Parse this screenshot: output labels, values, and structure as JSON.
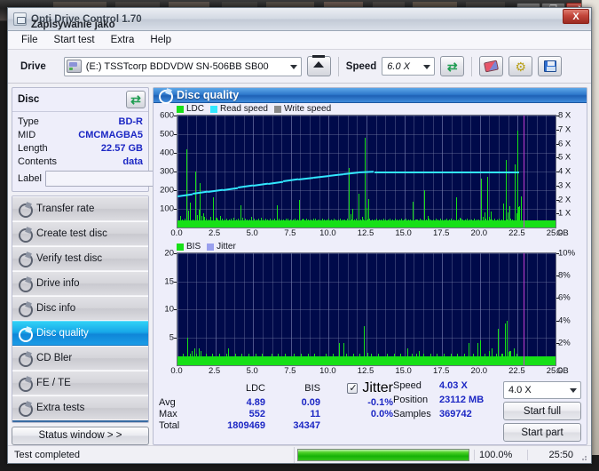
{
  "window": {
    "title": "Opti Drive Control 1.70",
    "subtitle": "Zapisywanie jako",
    "close_label": "X",
    "bg_minimize_label": "—",
    "bg_maximize_label": "❐",
    "bg_close_label": "X"
  },
  "menu": {
    "items": [
      {
        "label": "File"
      },
      {
        "label": "Start test"
      },
      {
        "label": "Extra"
      },
      {
        "label": "Help"
      }
    ]
  },
  "toolbar": {
    "drive_label": "Drive",
    "drive_value": "(E:)   TSSTcorp BDDVDW SN-506BB SB00",
    "eject_name": "eject-button",
    "speed_label": "Speed",
    "speed_value": "6.0 X",
    "refresh_glyph": "⇄",
    "gear_glyph": "⚙"
  },
  "disc": {
    "header": "Disc",
    "rows": [
      {
        "key": "Type",
        "value": "BD-R"
      },
      {
        "key": "MID",
        "value": "CMCMAGBA5"
      },
      {
        "key": "Length",
        "value": "22.57 GB"
      },
      {
        "key": "Contents",
        "value": "data"
      }
    ],
    "label_key": "Label",
    "label_value": "",
    "label_placeholder": ""
  },
  "sidebar": {
    "items": [
      {
        "label": "Transfer rate",
        "selected": false
      },
      {
        "label": "Create test disc",
        "selected": false
      },
      {
        "label": "Verify test disc",
        "selected": false
      },
      {
        "label": "Drive info",
        "selected": false
      },
      {
        "label": "Disc info",
        "selected": false
      },
      {
        "label": "Disc quality",
        "selected": true
      },
      {
        "label": "CD Bler",
        "selected": false
      },
      {
        "label": "FE / TE",
        "selected": false
      },
      {
        "label": "Extra tests",
        "selected": false
      }
    ],
    "status_button": "Status window > >"
  },
  "content": {
    "title": "Disc quality"
  },
  "chart_data": [
    {
      "id": "ldc-chart",
      "type": "bar",
      "title": "Disc quality",
      "xlabel": "GB",
      "ylabel": "LDC",
      "xlim": [
        0,
        25
      ],
      "ylim": [
        0,
        600
      ],
      "y2lim": [
        0,
        8
      ],
      "y2label": "X",
      "grid": true,
      "legend_position": "top-left",
      "xticks": [
        "0.0",
        "2.5",
        "5.0",
        "7.5",
        "10.0",
        "12.5",
        "15.0",
        "17.5",
        "20.0",
        "22.5",
        "25.0"
      ],
      "xunit": "GB",
      "yticks": [
        100,
        200,
        300,
        400,
        500,
        600
      ],
      "y2ticks": [
        "1 X",
        "2 X",
        "3 X",
        "4 X",
        "5 X",
        "6 X",
        "7 X",
        "8 X"
      ],
      "legend": [
        {
          "name": "LDC",
          "color": "#17e017"
        },
        {
          "name": "Read speed",
          "color": "#32e8ff"
        },
        {
          "name": "Write speed",
          "color": "#8a8a8a"
        }
      ],
      "series": [
        {
          "name": "LDC",
          "color": "#17e017",
          "x": [
            0.05,
            0.18,
            0.3,
            0.45,
            0.6,
            0.72,
            0.85,
            1.0,
            1.15,
            1.3,
            1.45,
            1.6,
            1.75,
            1.9,
            2.05,
            2.2,
            2.35,
            2.5,
            2.65,
            2.8,
            2.95,
            3.1,
            3.25,
            3.4,
            3.55,
            3.7,
            3.85,
            4.0,
            4.15,
            4.3,
            4.45,
            4.6,
            4.75,
            4.9,
            5.05,
            5.2,
            5.35,
            5.5,
            5.65,
            5.8,
            5.95,
            6.1,
            6.25,
            6.4,
            6.55,
            6.7,
            6.85,
            7.0,
            7.15,
            7.3,
            7.45,
            7.6,
            7.75,
            7.9,
            8.05,
            8.2,
            8.35,
            8.5,
            8.65,
            8.8,
            8.95,
            9.1,
            9.25,
            9.4,
            9.55,
            9.7,
            9.85,
            10.0,
            10.15,
            10.3,
            10.45,
            10.6,
            10.75,
            10.9,
            11.05,
            11.2,
            11.35,
            11.5,
            11.65,
            11.8,
            11.95,
            12.1,
            12.25,
            12.4,
            12.55,
            12.7,
            12.85,
            13.0,
            13.15,
            13.3,
            13.45,
            13.6,
            13.75,
            13.9,
            14.05,
            14.2,
            14.35,
            14.5,
            14.65,
            14.8,
            14.95,
            15.1,
            15.25,
            15.4,
            15.55,
            15.7,
            15.85,
            16.0,
            16.15,
            16.3,
            16.45,
            16.6,
            16.75,
            16.9,
            17.05,
            17.2,
            17.35,
            17.5,
            17.65,
            17.8,
            17.95,
            18.1,
            18.25,
            18.4,
            18.55,
            18.7,
            18.85,
            19.0,
            19.15,
            19.3,
            19.45,
            19.6,
            19.75,
            19.9,
            20.05,
            20.2,
            20.35,
            20.5,
            20.65,
            20.8,
            20.95,
            21.1,
            21.25,
            21.4,
            21.55,
            21.7,
            21.85,
            22.0,
            22.15,
            22.3,
            22.45,
            22.6
          ],
          "values": [
            40,
            60,
            45,
            50,
            420,
            70,
            55,
            45,
            300,
            50,
            240,
            60,
            55,
            48,
            42,
            55,
            160,
            52,
            45,
            60,
            48,
            44,
            50,
            42,
            46,
            52,
            44,
            46,
            120,
            52,
            48,
            45,
            44,
            58,
            46,
            44,
            48,
            52,
            44,
            46,
            42,
            48,
            44,
            46,
            120,
            50,
            44,
            42,
            46,
            48,
            44,
            42,
            46,
            44,
            150,
            44,
            42,
            46,
            44,
            42,
            46,
            48,
            44,
            42,
            46,
            44,
            42,
            48,
            44,
            46,
            42,
            44,
            48,
            44,
            42,
            46,
            320,
            44,
            42,
            46,
            180,
            44,
            42,
            480,
            44,
            46,
            42,
            44,
            48,
            44,
            42,
            46,
            44,
            42,
            48,
            44,
            46,
            42,
            44,
            48,
            44,
            46,
            42,
            44,
            140,
            44,
            42,
            46,
            44,
            200,
            42,
            46,
            44,
            42,
            48,
            44,
            46,
            42,
            44,
            48,
            44,
            46,
            42,
            160,
            44,
            46,
            42,
            44,
            48,
            44,
            42,
            46,
            44,
            42,
            260,
            44,
            46,
            270,
            44,
            42,
            48,
            44,
            46,
            42,
            130,
            360,
            44,
            46,
            42,
            340,
            520,
            44,
            46,
            120
          ]
        },
        {
          "name": "Read speed",
          "color": "#32e8ff",
          "x": [
            0.0,
            1.0,
            2.0,
            3.0,
            4.0,
            5.0,
            6.0,
            7.0,
            8.0,
            9.0,
            10.0,
            11.0,
            12.0,
            13.0,
            14.0,
            15.0,
            16.0,
            17.0,
            18.0,
            19.0,
            20.0,
            21.0,
            22.0,
            22.6
          ],
          "values": [
            2.3,
            2.45,
            2.6,
            2.75,
            2.9,
            3.05,
            3.2,
            3.35,
            3.5,
            3.62,
            3.74,
            3.86,
            3.98,
            4.03,
            4.03,
            4.03,
            4.03,
            4.03,
            4.03,
            4.03,
            4.03,
            4.03,
            4.03,
            4.03
          ]
        }
      ],
      "annotations": [
        {
          "type": "vline",
          "x": 22.9,
          "color": "#c23ad0"
        }
      ]
    },
    {
      "id": "bis-chart",
      "type": "bar",
      "xlabel": "GB",
      "ylabel": "BIS",
      "xlim": [
        0,
        25
      ],
      "ylim": [
        0,
        20
      ],
      "y2lim": [
        0,
        10
      ],
      "y2label": "%",
      "grid": true,
      "legend_position": "top-left",
      "xticks": [
        "0.0",
        "2.5",
        "5.0",
        "7.5",
        "10.0",
        "12.5",
        "15.0",
        "17.5",
        "20.0",
        "22.5",
        "25.0"
      ],
      "xunit": "GB",
      "yticks": [
        5,
        10,
        15,
        20
      ],
      "y2ticks": [
        "2%",
        "4%",
        "6%",
        "8%",
        "10%"
      ],
      "legend": [
        {
          "name": "BIS",
          "color": "#17e017"
        },
        {
          "name": "Jitter",
          "color": "#9aa0ee"
        }
      ],
      "series": [
        {
          "name": "BIS",
          "color": "#17e017",
          "x": [
            0.05,
            0.2,
            0.35,
            0.5,
            0.65,
            0.8,
            0.95,
            1.1,
            1.25,
            1.4,
            1.55,
            1.7,
            1.85,
            2.0,
            2.15,
            2.3,
            2.45,
            2.6,
            2.75,
            2.9,
            3.05,
            3.2,
            3.35,
            3.5,
            3.65,
            3.8,
            3.95,
            4.1,
            4.25,
            4.4,
            4.55,
            4.7,
            4.85,
            5.0,
            5.15,
            5.3,
            5.45,
            5.6,
            5.75,
            5.9,
            6.05,
            6.2,
            6.35,
            6.5,
            6.65,
            6.8,
            6.95,
            7.1,
            7.25,
            7.4,
            7.55,
            7.7,
            7.85,
            8.0,
            8.15,
            8.3,
            8.45,
            8.6,
            8.75,
            8.9,
            9.05,
            9.2,
            9.35,
            9.5,
            9.65,
            9.8,
            9.95,
            10.1,
            10.25,
            10.4,
            10.55,
            10.7,
            10.85,
            11.0,
            11.15,
            11.3,
            11.45,
            11.6,
            11.75,
            11.9,
            12.05,
            12.2,
            12.35,
            12.5,
            12.65,
            12.8,
            12.95,
            13.1,
            13.25,
            13.4,
            13.55,
            13.7,
            13.85,
            14.0,
            14.15,
            14.3,
            14.45,
            14.6,
            14.75,
            14.9,
            15.05,
            15.2,
            15.35,
            15.5,
            15.65,
            15.8,
            15.95,
            16.1,
            16.25,
            16.4,
            16.55,
            16.7,
            16.85,
            17.0,
            17.15,
            17.3,
            17.45,
            17.6,
            17.75,
            17.9,
            18.05,
            18.2,
            18.35,
            18.5,
            18.65,
            18.8,
            18.95,
            19.1,
            19.25,
            19.4,
            19.55,
            19.7,
            19.85,
            20.0,
            20.15,
            20.3,
            20.45,
            20.6,
            20.75,
            20.9,
            21.05,
            21.2,
            21.35,
            21.5,
            21.65,
            21.8,
            21.95,
            22.1,
            22.25,
            22.4,
            22.55,
            22.65
          ],
          "values": [
            1,
            1.5,
            2,
            1.5,
            5,
            2,
            2.5,
            3,
            2,
            3,
            2.5,
            1.5,
            2,
            1,
            1.5,
            2,
            1.5,
            1,
            2,
            1.5,
            1,
            2,
            3,
            1.5,
            1,
            2,
            1.5,
            1,
            2,
            1.5,
            1,
            2,
            1,
            1.5,
            2,
            1,
            1.5,
            2,
            1,
            1.5,
            1,
            2,
            1.5,
            1,
            2,
            1,
            1.5,
            2,
            1,
            1.5,
            1,
            2,
            1.5,
            1,
            2,
            1.5,
            1,
            2,
            1.5,
            1,
            2,
            1.5,
            1,
            1.5,
            1,
            2,
            1.5,
            1,
            2,
            1.5,
            1,
            4,
            1.5,
            4,
            2,
            1,
            1.5,
            2,
            1,
            1.5,
            2,
            1.5,
            7,
            1,
            1.5,
            2,
            1,
            1.5,
            2,
            1,
            1.5,
            1,
            2,
            1.5,
            1,
            2,
            1.5,
            1,
            2,
            1.5,
            1,
            3,
            1.5,
            2,
            1,
            2,
            2.5,
            1.5,
            2,
            1,
            1.5,
            2,
            1,
            1.5,
            2,
            1.5,
            1,
            2,
            1,
            1.5,
            2,
            1,
            1.5,
            2,
            1,
            1.5,
            2,
            1,
            4,
            1.5,
            2,
            1,
            4,
            4.5,
            1.5,
            2,
            1,
            2.5,
            3,
            1.5,
            2,
            6.5,
            1.5,
            2,
            7.5,
            8,
            2.5,
            1.5,
            3,
            2
          ]
        }
      ],
      "annotations": [
        {
          "type": "vline",
          "x": 22.9,
          "color": "#c23ad0"
        }
      ]
    }
  ],
  "stats": {
    "col_headers": [
      "LDC",
      "BIS"
    ],
    "jitter_header": "Jitter",
    "jitter_checked": true,
    "rows": [
      {
        "key": "Avg",
        "ldc": "4.89",
        "bis": "0.09",
        "jitter": "-0.1%"
      },
      {
        "key": "Max",
        "ldc": "552",
        "bis": "11",
        "jitter": "0.0%"
      },
      {
        "key": "Total",
        "ldc": "1809469",
        "bis": "34347",
        "jitter": ""
      }
    ]
  },
  "readout": {
    "speed_key": "Speed",
    "speed_value": "4.03 X",
    "position_key": "Position",
    "position_value": "23112 MB",
    "samples_key": "Samples",
    "samples_value": "369742",
    "speed_select_value": "4.0 X",
    "start_full_label": "Start full",
    "start_part_label": "Start part"
  },
  "statusbar": {
    "message": "Test completed",
    "progress_percent": "100.0%",
    "progress_value": 100,
    "elapsed": "25:50"
  },
  "colors": {
    "ldc_green": "#17e017",
    "read_cyan": "#32e8ff",
    "write_gray": "#8a8a8a",
    "jitter_lilac": "#9aa0ee",
    "plot_bg": "#000a4a",
    "accent_blue": "#2f79cc",
    "value_blue": "#1c27c4",
    "marker_magenta": "#c23ad0"
  }
}
